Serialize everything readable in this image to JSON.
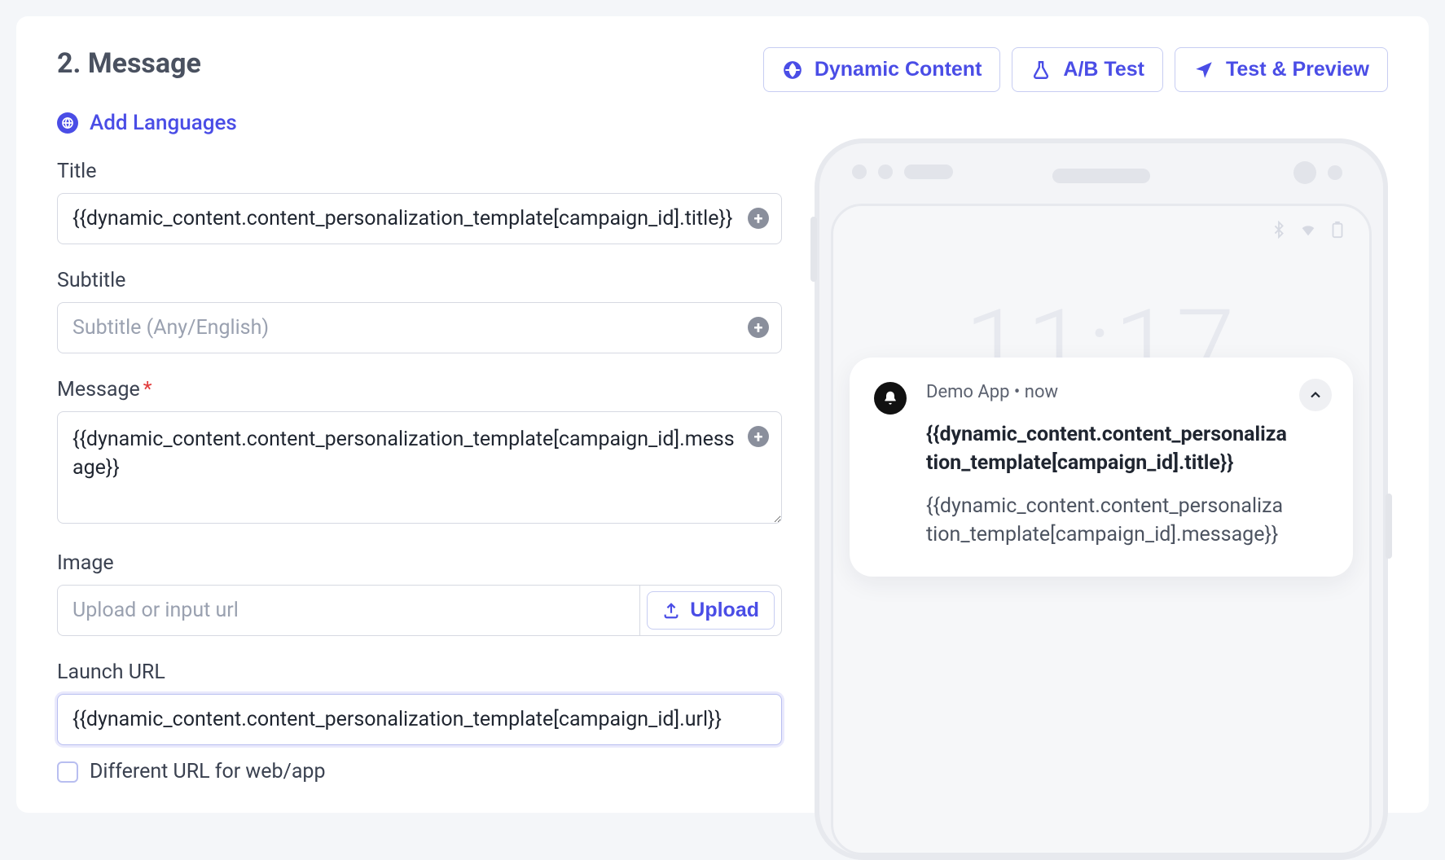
{
  "section_title": "2. Message",
  "header": {
    "dynamic_content": "Dynamic Content",
    "ab_test": "A/B Test",
    "test_preview": "Test & Preview"
  },
  "add_languages_label": "Add Languages",
  "fields": {
    "title": {
      "label": "Title",
      "value": "{{dynamic_content.content_personalization_template[campaign_id].title}}"
    },
    "subtitle": {
      "label": "Subtitle",
      "placeholder": "Subtitle (Any/English)",
      "value": ""
    },
    "message": {
      "label": "Message",
      "value": "{{dynamic_content.content_personalization_template[campaign_id].message}}"
    },
    "image": {
      "label": "Image",
      "placeholder": "Upload or input url",
      "value": "",
      "upload_label": "Upload"
    },
    "launch_url": {
      "label": "Launch URL",
      "value": "{{dynamic_content.content_personalization_template[campaign_id].url}}"
    },
    "different_url_label": "Different URL for web/app"
  },
  "preview": {
    "clock": "11:17",
    "app_meta": "Demo App • now",
    "title": "{{dynamic_content.content_personalization_template[campaign_id].title}}",
    "message": "{{dynamic_content.content_personalization_template[campaign_id].message}}"
  }
}
